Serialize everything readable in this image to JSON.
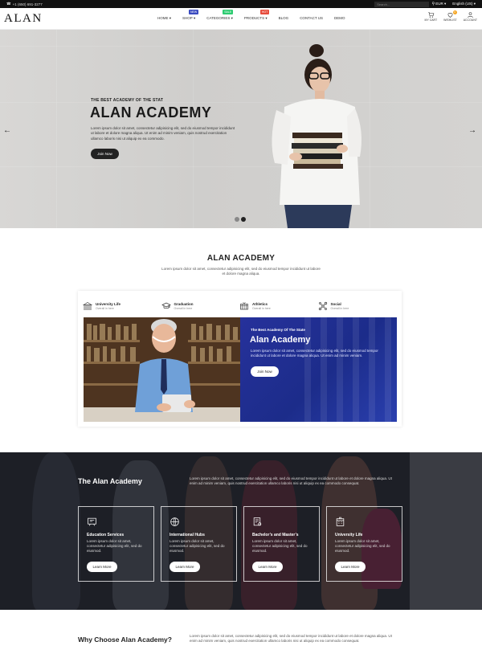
{
  "topbar": {
    "phone": "+1 (650) 691-3277",
    "search_placeholder": "Search...",
    "currency": "EUR",
    "language": "English (US)"
  },
  "header": {
    "logo": "ALAN",
    "nav": [
      {
        "label": "HOME",
        "caret": true,
        "badge": "",
        "badge_color": ""
      },
      {
        "label": "SHOP",
        "caret": true,
        "badge": "NEW",
        "badge_color": "#3b4cc0"
      },
      {
        "label": "CATEGORIES",
        "caret": true,
        "badge": "SALE",
        "badge_color": "#2ecc71"
      },
      {
        "label": "PRODUCTS",
        "caret": true,
        "badge": "HOT",
        "badge_color": "#e74c3c"
      },
      {
        "label": "BLOG",
        "caret": false,
        "badge": "",
        "badge_color": ""
      },
      {
        "label": "CONTACT US",
        "caret": false,
        "badge": "",
        "badge_color": ""
      },
      {
        "label": "DEMO",
        "caret": false,
        "badge": "",
        "badge_color": ""
      }
    ],
    "icons": {
      "cart_label": "MY CART",
      "wishlist_label": "WISHLIST",
      "wishlist_count": "0",
      "account_label": "ACCOUNT"
    }
  },
  "hero": {
    "subtitle": "THE BEST ACADEMY OF THE STAT",
    "title": "ALAN ACADEMY",
    "description": "Lorem ipsum dolor sit amet, consectetur adipisicing elit, sed do eiusmod tempor incididunt ut labore et dolore magna aliqua. Ut enim ad minim veniam, quis nostrud exercitation ullamco laboris nisi ut aliquip ex ea commodo.",
    "button": "Join Now",
    "prev_icon": "arrow-left-icon",
    "next_icon": "arrow-right-icon"
  },
  "about": {
    "title": "ALAN ACADEMY",
    "description": "Lorem ipsum dolor sit amet, consectetur adipisicing elit, sed do eiusmod tempor incididunt ut labore et dolore magna aliqua.",
    "tabs": [
      {
        "title": "University Life",
        "subtitle": "Overall in here",
        "icon": "university-icon"
      },
      {
        "title": "Graduation",
        "subtitle": "Overall in here",
        "icon": "graduation-cap-icon"
      },
      {
        "title": "Athletics",
        "subtitle": "Overall in here",
        "icon": "stadium-icon"
      },
      {
        "title": "Social",
        "subtitle": "Overall in here",
        "icon": "network-icon"
      }
    ],
    "panel": {
      "subtitle": "The Best Academy Of The State",
      "title": "Alan Academy",
      "description": "Lorem ipsum dolor sit amet, consectetur adipisicing elit, sed do eiusmod tempor incididunt ut labore et dolore magna aliqua. Ut enim ad minim veniam.",
      "button": "Join Now"
    }
  },
  "services": {
    "title": "The Alan Academy",
    "description": "Lorem ipsum dolor sit amet, consectetur adipisicing elit, sed do eiusmod tempor incididunt ut labore et dolore magna aliqua. Ut enim ad minim veniam, quis nostrud exercitation ullamco laboris nisi ut aliquip ex ea commodo consequat.",
    "items": [
      {
        "title": "Education Services",
        "description": "Lorem ipsum dolor sit amet, consectetur adipisicing elit, sed do eiusmod.",
        "button": "Learn More",
        "icon": "blackboard-icon"
      },
      {
        "title": "International Hubs",
        "description": "Lorem ipsum dolor sit amet, consectetur adipisicing elit, sed do eiusmod.",
        "button": "Learn More",
        "icon": "globe-icon"
      },
      {
        "title": "Bachelor’s and Master’s",
        "description": "Lorem ipsum dolor sit amet, consectetur adipisicing elit, sed do eiusmod.",
        "button": "Learn More",
        "icon": "certificate-icon"
      },
      {
        "title": "University Life",
        "description": "Lorem ipsum dolor sit amet, consectetur adipisicing elit, sed do eiusmod.",
        "button": "Learn More",
        "icon": "building-icon"
      }
    ]
  },
  "why": {
    "title": "Why Choose Alan Academy?",
    "description": "Lorem ipsum dolor sit amet, consectetur adipisicing elit, sed do eiusmod tempor incididunt ut labore et dolore magna aliqua. Ut enim ad minim veniam, quis nostrud exercitation ullamco laboris nisi ut aliquip ex ea commodo consequat."
  }
}
